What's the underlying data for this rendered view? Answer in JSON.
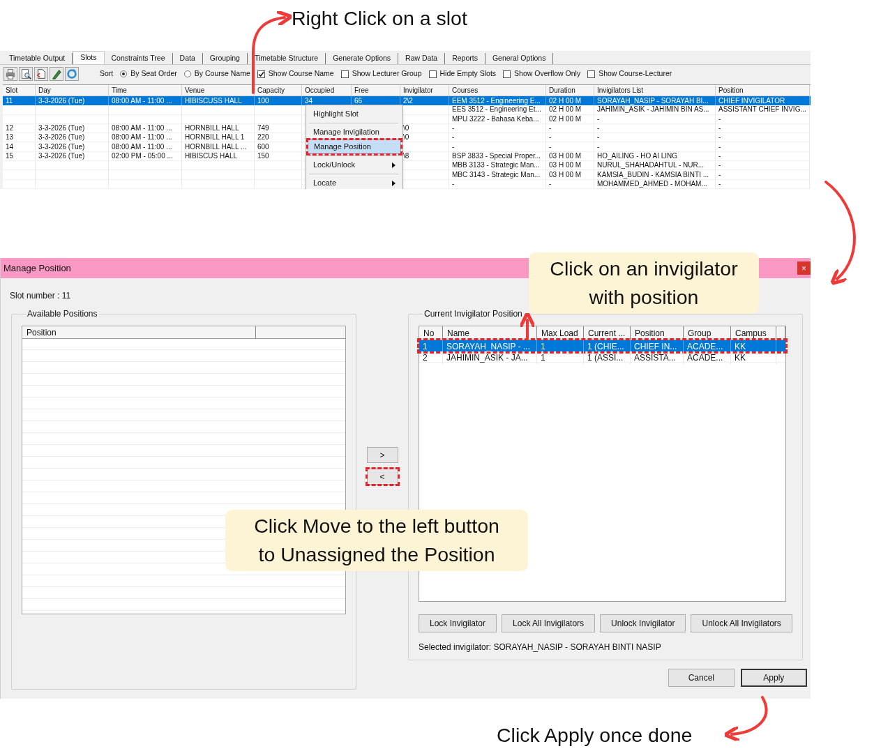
{
  "annotations": [
    {
      "kind": "plain",
      "text": "Right Click on a slot"
    },
    {
      "kind": "callout",
      "text": "Click on an invigilator with position"
    },
    {
      "kind": "callout",
      "text": "Click Move to the left button to Unassigned the Position"
    },
    {
      "kind": "plain",
      "text": "Click Apply once done"
    }
  ],
  "main_window": {
    "tabs": [
      {
        "label": "Timetable Output",
        "selected": false
      },
      {
        "label": "Slots",
        "selected": true
      },
      {
        "label": "Constraints Tree",
        "selected": false
      },
      {
        "label": "Data",
        "selected": false
      },
      {
        "label": "Grouping",
        "selected": false
      },
      {
        "label": "Timetable Structure",
        "selected": false
      },
      {
        "label": "Generate Options",
        "selected": false
      },
      {
        "label": "Raw Data",
        "selected": false
      },
      {
        "label": "Reports",
        "selected": false
      },
      {
        "label": "General Options",
        "selected": false
      }
    ],
    "toolbar": {
      "sort_label": "Sort",
      "sort_options": [
        {
          "label": "By Seat Order",
          "selected": true
        },
        {
          "label": "By Course Name",
          "selected": false
        }
      ],
      "checkboxes": [
        {
          "label": "Show Course Name",
          "checked": true
        },
        {
          "label": "Show Lecturer Group",
          "checked": false
        },
        {
          "label": "Hide Empty Slots",
          "checked": false
        },
        {
          "label": "Show Overflow Only",
          "checked": false
        },
        {
          "label": "Show Course-Lecturer",
          "checked": false
        }
      ]
    },
    "grid": {
      "columns": [
        "Slot",
        "Day",
        "Time",
        "Venue",
        "Capacity",
        "Occupied",
        "Free",
        "Invigilator",
        "Courses",
        "Duration",
        "Invigilators List",
        "Position"
      ],
      "rows": [
        {
          "selected": true,
          "cells": [
            "11",
            "3-3-2026 (Tue)",
            "08:00 AM - 11:00 ...",
            "HIBISCUSS HALL",
            "100",
            "34",
            "66",
            "2\\2",
            "EEM 3512 - Engineering E...",
            "02 H 00 M",
            "SORAYAH_NASIP - SORAYAH BI...",
            "CHIEF INVIGILATOR"
          ]
        },
        {
          "selected": false,
          "cells": [
            null,
            null,
            null,
            null,
            null,
            null,
            null,
            null,
            "EES 3512 - Engineering Et...",
            "02 H 00 M",
            "JAHIMIN_ASIK - JAHIMIN BIN AS...",
            "ASSISTANT CHIEF INVIG..."
          ]
        },
        {
          "selected": false,
          "cells": [
            null,
            null,
            null,
            null,
            null,
            null,
            null,
            null,
            "MPU 3222 - Bahasa Keba...",
            "02 H 00 M",
            "-",
            "-"
          ]
        },
        {
          "selected": false,
          "cells": [
            "12",
            "3-3-2026 (Tue)",
            "08:00 AM - 11:00 ...",
            "HORNBILL HALL",
            "749",
            null,
            null,
            "\\0",
            "-",
            "-",
            "-",
            "-"
          ]
        },
        {
          "selected": false,
          "cells": [
            "13",
            "3-3-2026 (Tue)",
            "08:00 AM - 11:00 ...",
            "HORNBILL HALL 1",
            "220",
            null,
            null,
            "\\0",
            "-",
            "-",
            "-",
            "-"
          ]
        },
        {
          "selected": false,
          "cells": [
            "14",
            "3-3-2026 (Tue)",
            "08:00 AM - 11:00 ...",
            "HORNBILL HALL ...",
            "600",
            null,
            null,
            null,
            "-",
            "-",
            "-",
            "-"
          ]
        },
        {
          "selected": false,
          "cells": [
            "15",
            "3-3-2026 (Tue)",
            "02:00 PM - 05:00 ...",
            "HIBISCUS HALL",
            "150",
            null,
            null,
            "\\8",
            "BSP 3833 - Special Proper...",
            "03 H 00 M",
            "HO_AILING - HO AI LING",
            "-"
          ]
        },
        {
          "selected": false,
          "cells": [
            null,
            null,
            null,
            null,
            null,
            null,
            null,
            null,
            "MBB 3133 - Strategic Man...",
            "03 H 00 M",
            "NURUL_SHAHADAHTUL - NUR...",
            "-"
          ]
        },
        {
          "selected": false,
          "cells": [
            null,
            null,
            null,
            null,
            null,
            null,
            null,
            null,
            "MBC 3143 - Strategic Man...",
            "03 H 00 M",
            "KAMSIA_BUDIN - KAMSIA BINTI ...",
            "-"
          ]
        },
        {
          "selected": false,
          "cells": [
            null,
            null,
            null,
            null,
            null,
            null,
            null,
            null,
            "-",
            "-",
            "MOHAMMED_AHMED - MOHAM...",
            "-"
          ]
        }
      ]
    },
    "context_menu": [
      {
        "label": "Highlight Slot",
        "submenu": false,
        "highlighted": false,
        "marked": false,
        "separator_after": true
      },
      {
        "label": "Manage Invigilation",
        "submenu": false,
        "highlighted": false,
        "marked": false,
        "separator_after": false
      },
      {
        "label": "Manage Position",
        "submenu": false,
        "highlighted": true,
        "marked": true,
        "separator_after": true
      },
      {
        "label": "Lock/Unlock",
        "submenu": true,
        "highlighted": false,
        "marked": false,
        "separator_after": true
      },
      {
        "label": "Locate",
        "submenu": true,
        "highlighted": false,
        "marked": false,
        "separator_after": false
      }
    ]
  },
  "dialog": {
    "title": "Manage Position",
    "close": "×",
    "slot_number": "Slot number : 11",
    "available": {
      "title": "Available Positions",
      "columns": [
        "Position"
      ]
    },
    "move_buttons": [
      {
        "label": ">",
        "marked": false
      },
      {
        "label": "<",
        "marked": true
      }
    ],
    "current": {
      "title": "Current Invigilator Position",
      "columns": [
        "No",
        "Name",
        "Max Load",
        "Current ...",
        "Position",
        "Group",
        "Campus"
      ],
      "rows": [
        {
          "selected": true,
          "marked": true,
          "cells": [
            "1",
            "SORAYAH_NASIP - ...",
            "1",
            "1 (CHIE...",
            "CHIEF IN...",
            "ACADE...",
            "KK"
          ]
        },
        {
          "selected": false,
          "marked": false,
          "cells": [
            "2",
            "JAHIMIN_ASIK - JA...",
            "1",
            "1 (ASSI...",
            "ASSISTA...",
            "ACADE...",
            "KK"
          ]
        }
      ]
    },
    "lock_buttons": [
      "Lock Invigilator",
      "Lock All Invigilators",
      "Unlock Invigilator",
      "Unlock All Invigilators"
    ],
    "selected_text": "Selected invigilator: SORAYAH_NASIP - SORAYAH BINTI NASIP",
    "footer_buttons": [
      {
        "label": "Cancel",
        "default": false
      },
      {
        "label": "Apply",
        "default": true
      }
    ]
  }
}
